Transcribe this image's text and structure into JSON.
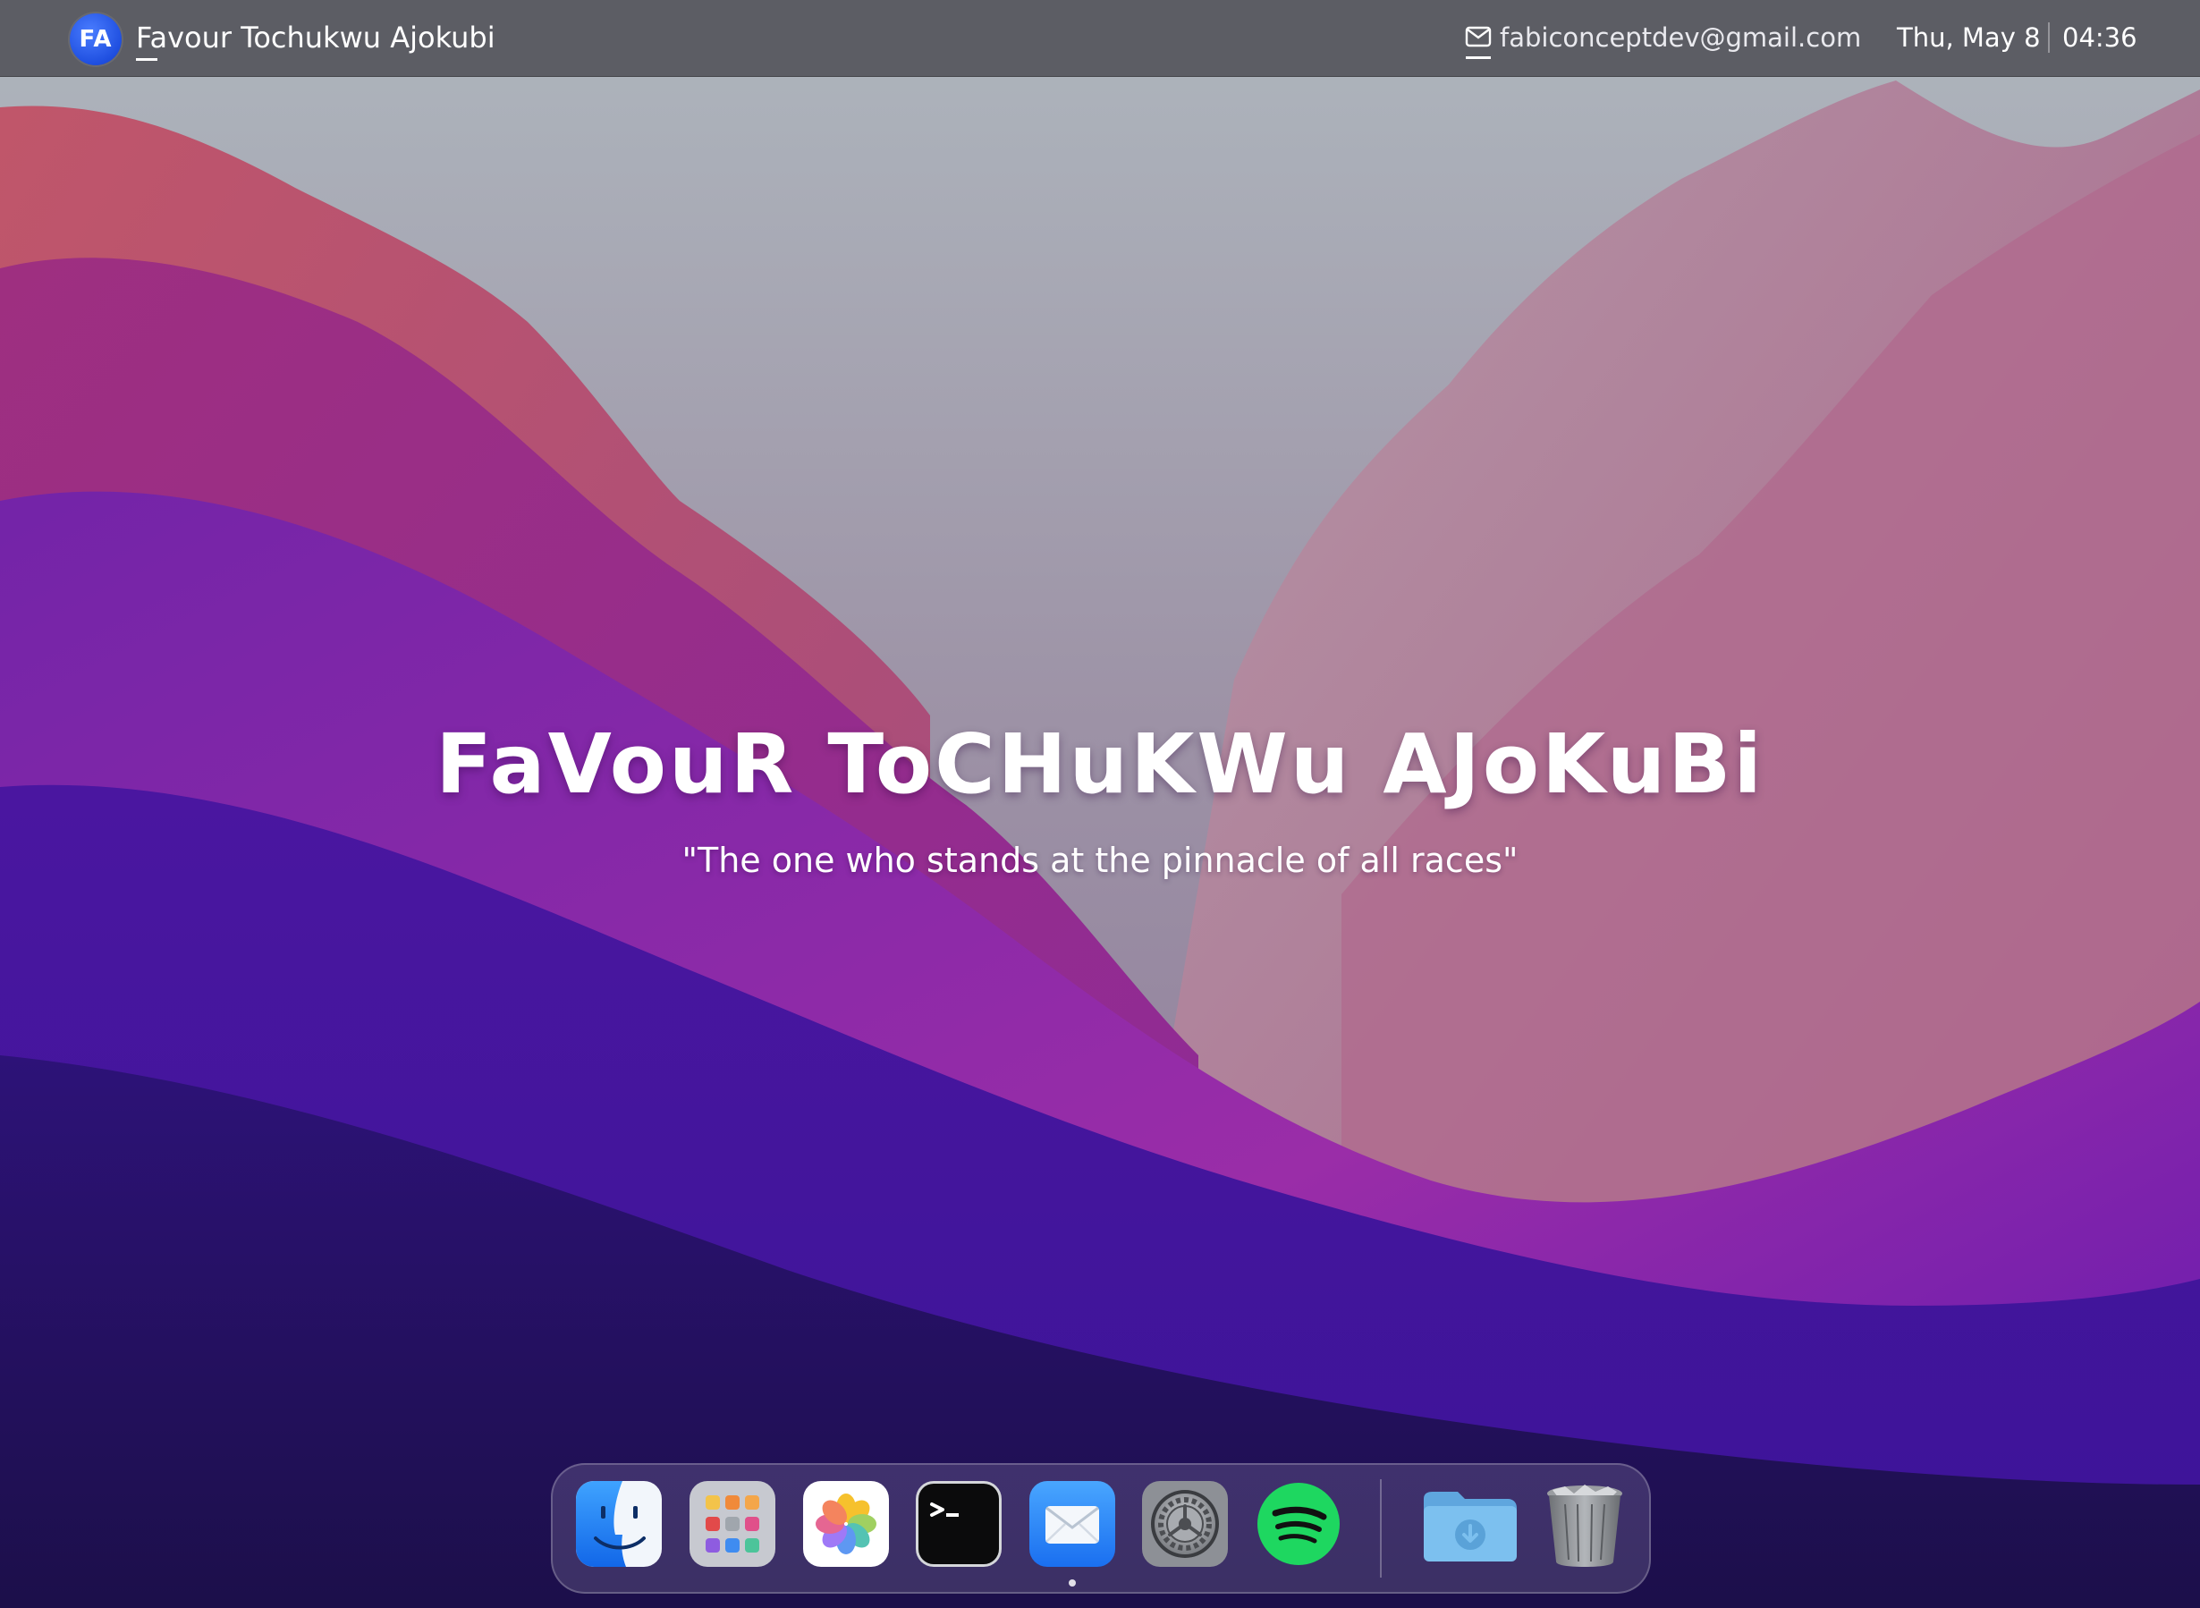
{
  "menubar": {
    "avatar_initials": "FA",
    "owner_name": "Favour Tochukwu Ajokubi",
    "email_icon": "mail-icon",
    "email": "fabiconceptdev@gmail.com",
    "date": "Thu, May 8",
    "time": "04:36"
  },
  "hero": {
    "title": "FaVouR ToCHuKWu AJoKuBi",
    "quote": "\"The one who stands at the pinnacle of all races\""
  },
  "dock": {
    "apps": [
      {
        "icon": "finder-icon"
      },
      {
        "icon": "launchpad-icon"
      },
      {
        "icon": "photos-icon"
      },
      {
        "icon": "terminal-icon"
      },
      {
        "icon": "mail-app-icon",
        "running": true
      },
      {
        "icon": "system-settings-icon"
      },
      {
        "icon": "spotify-icon"
      },
      {
        "icon": "downloads-folder-icon"
      },
      {
        "icon": "trash-icon"
      }
    ]
  },
  "colors": {
    "menubar": "#585a60",
    "accent_blue": "#1f4fe0",
    "wallpaper_top": "#b0b2bc",
    "wallpaper_bottom": "#1e1050",
    "spotify_green": "#1ed760"
  }
}
